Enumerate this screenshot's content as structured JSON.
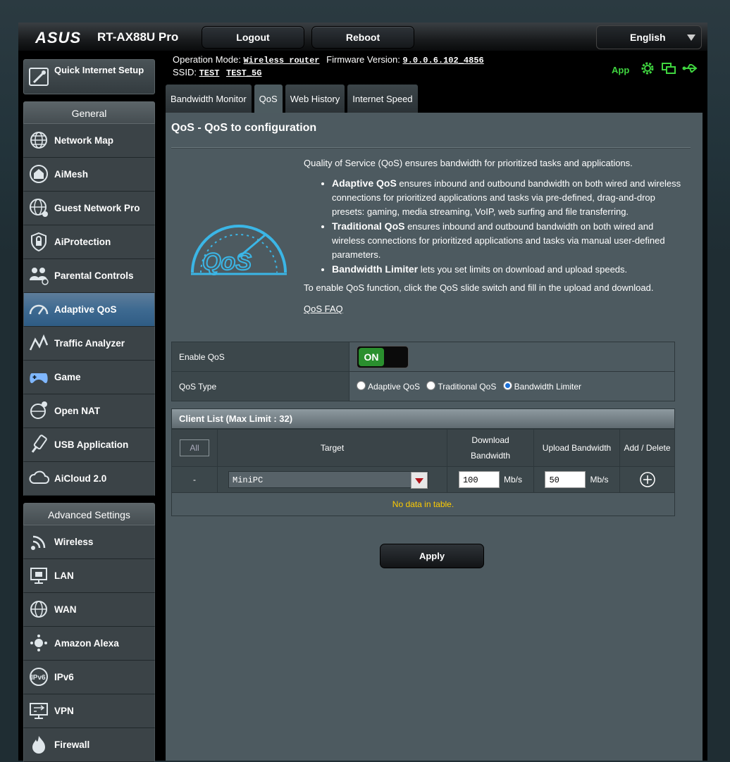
{
  "header": {
    "brand": "ASUS",
    "model": "RT-AX88U Pro",
    "logout_label": "Logout",
    "reboot_label": "Reboot",
    "language": "English"
  },
  "info": {
    "op_mode_label": "Operation Mode:",
    "op_mode_value": "Wireless router",
    "fw_label": "Firmware Version:",
    "fw_value": "9.0.0.6.102_4856",
    "ssid_label": "SSID:",
    "ssid_1": "TEST",
    "ssid_2": "TEST_5G",
    "app_label": "App"
  },
  "sidebar": {
    "qis_label": "Quick Internet Setup",
    "general_title": "General",
    "general_items": [
      {
        "label": "Network Map",
        "icon": "globe-icon"
      },
      {
        "label": "AiMesh",
        "icon": "aimesh-icon"
      },
      {
        "label": "Guest Network Pro",
        "icon": "guest-globe-icon"
      },
      {
        "label": "AiProtection",
        "icon": "shield-lock-icon"
      },
      {
        "label": "Parental Controls",
        "icon": "family-icon"
      },
      {
        "label": "Adaptive QoS",
        "icon": "speedometer-icon"
      },
      {
        "label": "Traffic Analyzer",
        "icon": "traffic-chart-icon"
      },
      {
        "label": "Game",
        "icon": "gamepad-icon"
      },
      {
        "label": "Open NAT",
        "icon": "open-nat-icon"
      },
      {
        "label": "USB Application",
        "icon": "usb-icon"
      },
      {
        "label": "AiCloud 2.0",
        "icon": "cloud-icon"
      }
    ],
    "advanced_title": "Advanced Settings",
    "advanced_items": [
      {
        "label": "Wireless",
        "icon": "wireless-icon"
      },
      {
        "label": "LAN",
        "icon": "lan-icon"
      },
      {
        "label": "WAN",
        "icon": "wan-globe-icon"
      },
      {
        "label": "Amazon Alexa",
        "icon": "alexa-icon"
      },
      {
        "label": "IPv6",
        "icon": "ipv6-icon"
      },
      {
        "label": "VPN",
        "icon": "vpn-icon"
      },
      {
        "label": "Firewall",
        "icon": "firewall-icon"
      }
    ]
  },
  "tabs": [
    "Bandwidth Monitor",
    "QoS",
    "Web History",
    "Internet Speed"
  ],
  "main": {
    "title": "QoS - QoS to configuration",
    "intro": "Quality of Service (QoS) ensures bandwidth for prioritized tasks and applications.",
    "b1_title": "Adaptive QoS",
    "b1_text": " ensures inbound and outbound bandwidth on both wired and wireless connections for prioritized applications and tasks via pre-defined, drag-and-drop presets: gaming, media streaming, VoIP, web surfing and file transferring.",
    "b2_title": "Traditional QoS",
    "b2_text": " ensures inbound and outbound bandwidth on both wired and wireless connections for prioritized applications and tasks via manual user-defined parameters.",
    "b3_title": "Bandwidth Limiter",
    "b3_text": " lets you set limits on download and upload speeds.",
    "enable_text": "To enable QoS function, click the QoS slide switch and fill in the upload and download.",
    "faq": "QoS FAQ",
    "logo_text": "QoS"
  },
  "settings": {
    "enable_label": "Enable QoS",
    "enable_state": "ON",
    "type_label": "QoS Type",
    "types": [
      "Adaptive QoS",
      "Traditional QoS",
      "Bandwidth Limiter"
    ],
    "selected_type": "Bandwidth Limiter"
  },
  "client_list": {
    "caption": "Client List (Max Limit : 32)",
    "all_label": "All",
    "col_target": "Target",
    "col_download_1": "Download",
    "col_download_2": "Bandwidth",
    "col_upload": "Upload Bandwidth",
    "col_add_delete": "Add / Delete",
    "row_dash": "-",
    "target_value": "MiniPC",
    "download_value": "100",
    "upload_value": "50",
    "unit": "Mb/s",
    "no_data": "No data in table."
  },
  "apply_label": "Apply"
}
